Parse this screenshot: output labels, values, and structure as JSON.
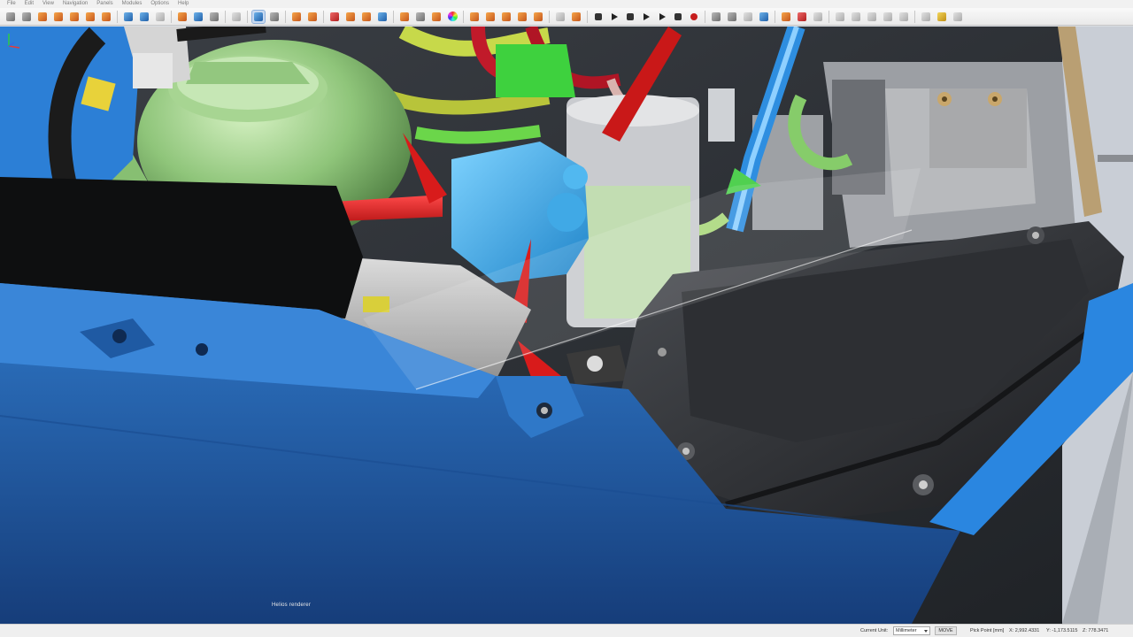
{
  "menu": [
    "File",
    "Edit",
    "View",
    "Navigation",
    "Panels",
    "Modules",
    "Options",
    "Help"
  ],
  "toolbar": {
    "icons": [
      "select-icon",
      "pen-icon",
      "box-icon",
      "cube-icon",
      "cube-icon",
      "sphere-icon",
      "cube-icon",
      "sep",
      "copy-icon",
      "paste-icon",
      "fold-icon",
      "sep",
      "cut-icon",
      "tool-icon",
      "delete-icon",
      "sep",
      "shape-icon",
      "sep",
      "navigate-icon",
      "rotate-icon",
      "sep",
      "move-icon",
      "cube-icon",
      "sep",
      "frame-icon",
      "camera-icon",
      "screenshot-icon",
      "person-icon",
      "sep",
      "cube-icon",
      "layer-icon",
      "sphere-icon",
      "color-wheel-icon",
      "sep",
      "cube-icon",
      "cube-icon",
      "cube-icon",
      "cube-icon",
      "box-icon",
      "sep",
      "grid-icon",
      "globe-icon",
      "sep",
      "skip-start-icon",
      "step-back-icon",
      "pause-icon",
      "play-icon",
      "step-forward-icon",
      "stop-icon",
      "record-icon",
      "sep",
      "viewpoint-icon",
      "display-icon",
      "layout-icon",
      "pointer-icon",
      "sep",
      "cube-icon",
      "x-icon",
      "window-icon",
      "sep",
      "align-icon",
      "align-icon",
      "zoom-icon",
      "zoom-icon",
      "layout-icon",
      "sep",
      "settings-icon",
      "eyedropper-icon",
      "help-icon"
    ]
  },
  "viewport": {
    "renderer_label": "Helios renderer"
  },
  "status": {
    "unit_label": "Current Unit:",
    "unit_value": "Millimeter",
    "mode": "MOVE",
    "pick_label": "Pick Point [mm]",
    "x": "X: 2,992.4331",
    "y": "Y: -1,173.5115",
    "z": "Z: 778.3471"
  }
}
